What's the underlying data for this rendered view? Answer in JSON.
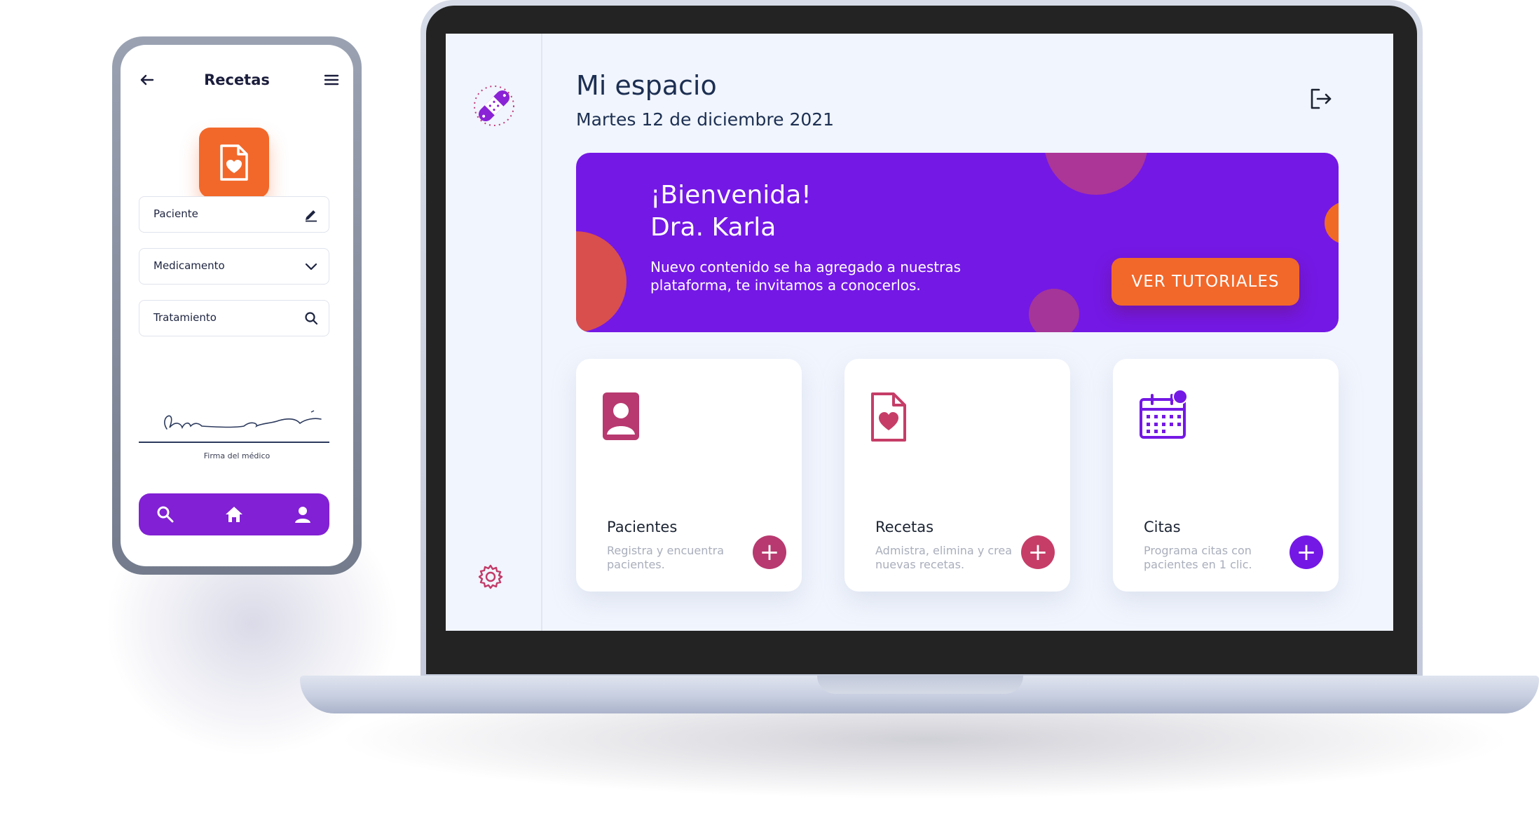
{
  "phone": {
    "title": "Recetas",
    "fields": [
      {
        "label": "Paciente",
        "icon": "pencil-icon"
      },
      {
        "label": "Medicamento",
        "icon": "chevron-down-icon"
      },
      {
        "label": "Tratamiento",
        "icon": "search-icon"
      }
    ],
    "signature_label": "Firma del médico",
    "nav": [
      "search-icon",
      "home-icon",
      "user-icon"
    ],
    "colors": {
      "accent": "#f2682a",
      "nav": "#8120d4"
    }
  },
  "desktop": {
    "title": "Mi espacio",
    "date": "Martes 12 de diciembre 2021",
    "banner": {
      "greeting": "¡Bienvenida!",
      "name": "Dra. Karla",
      "message": "Nuevo contenido se ha agregado a nuestras plataforma, te invitamos a conocerlos.",
      "button": "VER TUTORIALES",
      "color": "#7418e5"
    },
    "cards": [
      {
        "title": "Pacientes",
        "description": "Registra y encuentra pacientes.",
        "icon": "patient-icon",
        "color": "#b8396f"
      },
      {
        "title": "Recetas",
        "description": "Admistra, elimina y crea nuevas recetas.",
        "icon": "prescription-icon",
        "color": "#c63d68"
      },
      {
        "title": "Citas",
        "description": "Programa citas con pacientes en 1 clic.",
        "icon": "calendar-icon",
        "color": "#7418e5"
      }
    ],
    "add_symbol": "+"
  }
}
